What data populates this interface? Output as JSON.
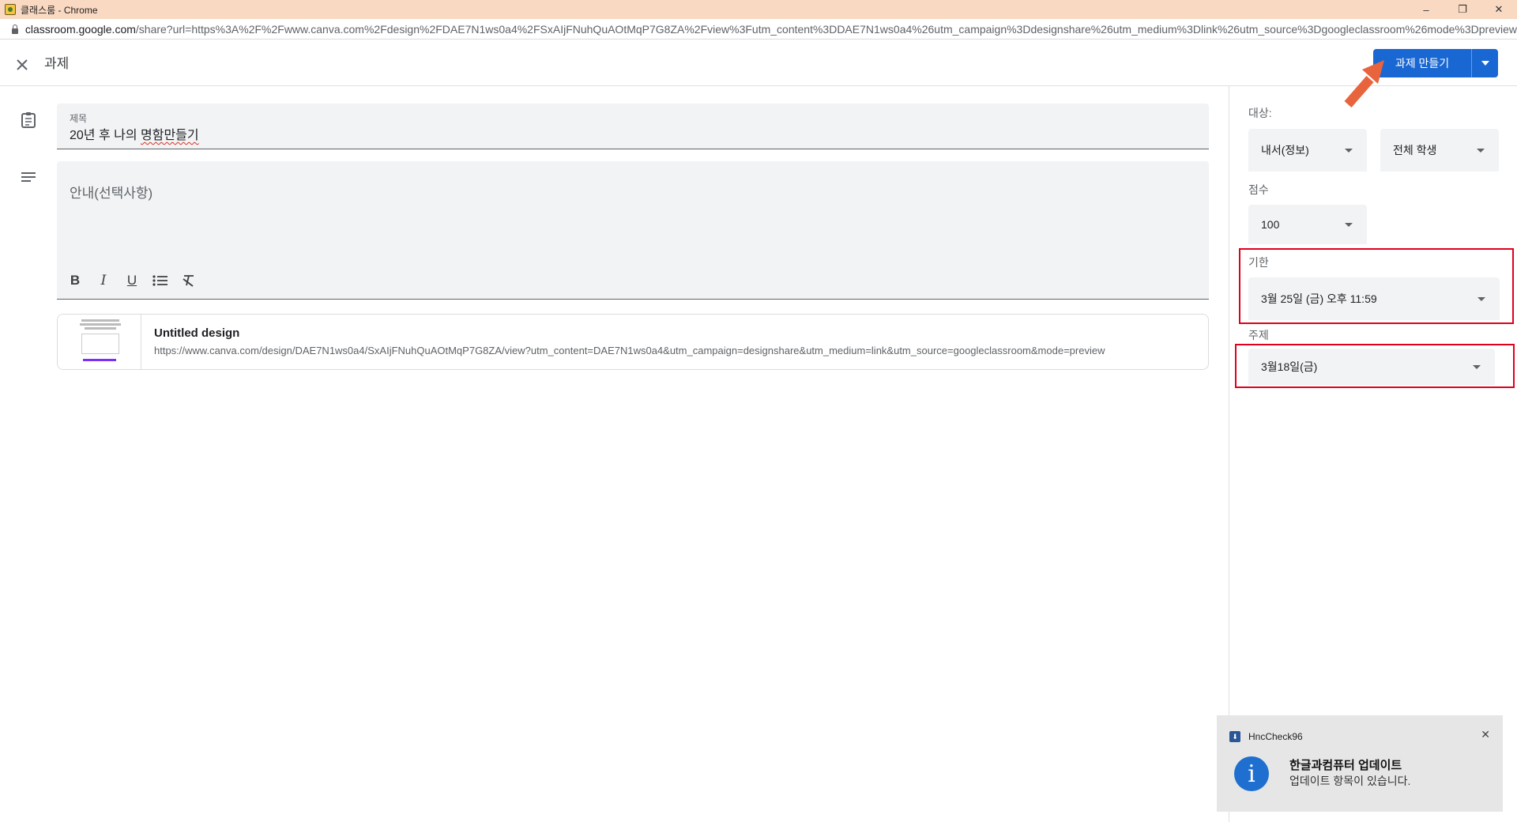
{
  "window": {
    "title": "클래스룸 - Chrome",
    "controls": [
      "–",
      "❐",
      "✕"
    ]
  },
  "urlbar": {
    "host": "classroom.google.com",
    "rest": "/share?url=https%3A%2F%2Fwww.canva.com%2Fdesign%2FDAE7N1ws0a4%2FSxAIjFNuhQuAOtMqP7G8ZA%2Fview%3Futm_content%3DDAE7N1ws0a4%26utm_campaign%3Ddesignshare%26utm_medium%3Dlink%26utm_source%3Dgoogleclassroom%26mode%3Dpreview"
  },
  "header": {
    "title": "과제",
    "create_label": "과제 만들기"
  },
  "form": {
    "title_label": "제목",
    "title_value_prefix": "20년 후 나의 ",
    "title_value_misspelled": "명함만들기",
    "description_placeholder": "안내(선택사항)",
    "toolbar": {
      "bold": "B",
      "italic": "I",
      "underline": "U"
    }
  },
  "attachment": {
    "name": "Untitled design",
    "url": "https://www.canva.com/design/DAE7N1ws0a4/SxAIjFNuhQuAOtMqP7G8ZA/view?utm_content=DAE7N1ws0a4&utm_campaign=designshare&utm_medium=link&utm_source=googleclassroom&mode=preview"
  },
  "panel": {
    "for_label": "대상:",
    "class_value": "내서(정보)",
    "students_value": "전체 학생",
    "points_label": "점수",
    "points_value": "100",
    "due_label": "기한",
    "due_value": "3월 25일 (금) 오후 11:59",
    "topic_label": "주제",
    "topic_value": "3월18일(금)"
  },
  "notification": {
    "app": "HncCheck96",
    "title": "한글과컴퓨터 업데이트",
    "message": "업데이트 항목이 있습니다."
  },
  "colors": {
    "primary": "#1967d2",
    "highlight": "#e0001b",
    "annotation_arrow": "#e8643c"
  }
}
